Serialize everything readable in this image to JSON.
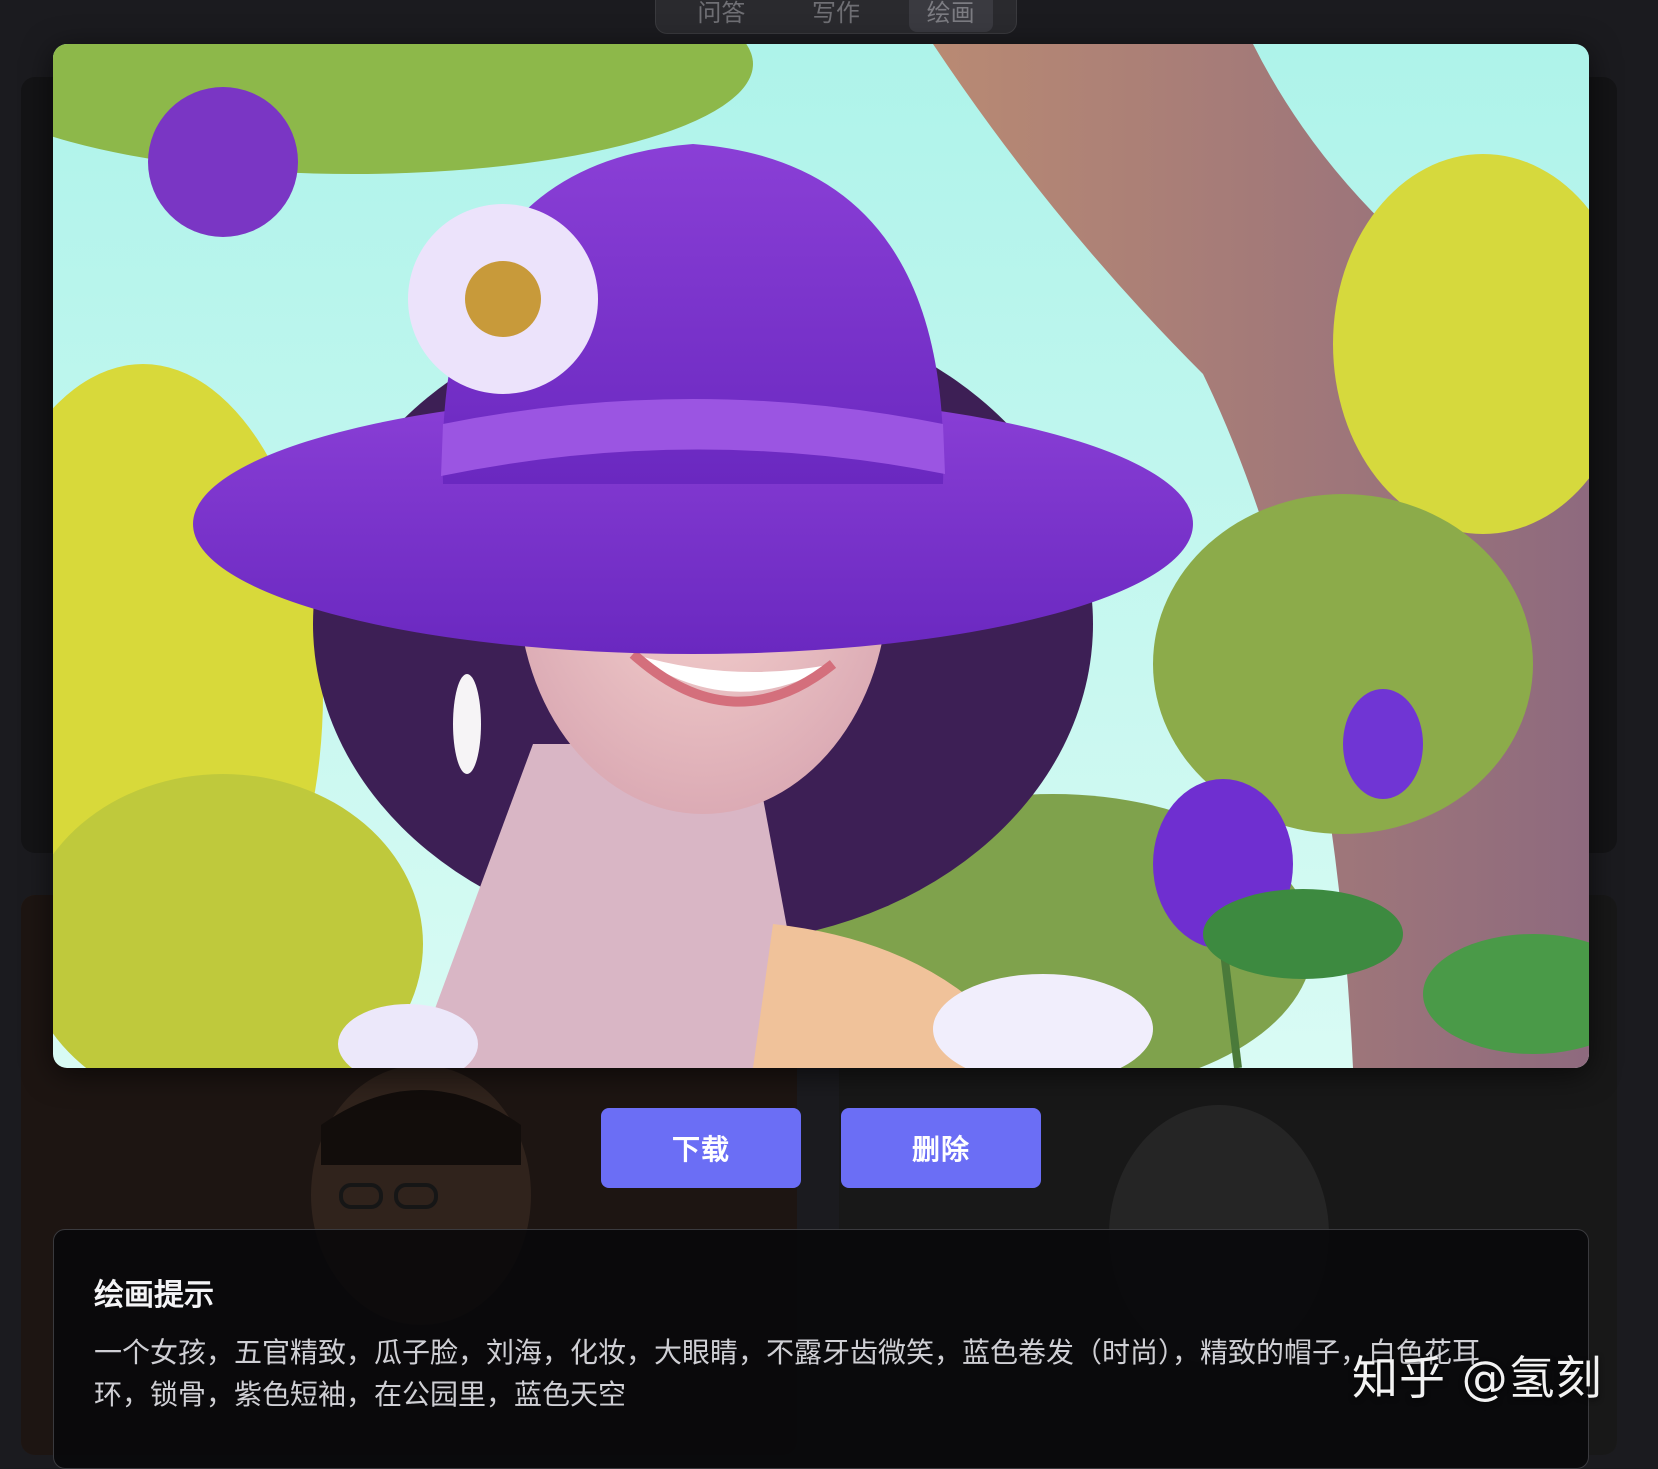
{
  "tabs": [
    {
      "label": "问答",
      "active": false
    },
    {
      "label": "写作",
      "active": false
    },
    {
      "label": "绘画",
      "active": true
    }
  ],
  "modal": {
    "image": {
      "subject": "woman-purple-hat-portrait"
    },
    "buttons": {
      "download_label": "下载",
      "delete_label": "删除"
    },
    "prompt": {
      "title": "绘画提示",
      "text": "一个女孩，五官精致，瓜子脸，刘海，化妆，大眼睛，不露牙齿微笑，蓝色卷发（时尚），精致的帽子，白色花耳环，锁骨，紫色短袖，在公园里，蓝色天空"
    }
  },
  "watermark": "知乎 @氢刻",
  "colors": {
    "accent": "#6b6ef5",
    "background": "#1b1b1f",
    "panel": "#0a0a0c"
  }
}
